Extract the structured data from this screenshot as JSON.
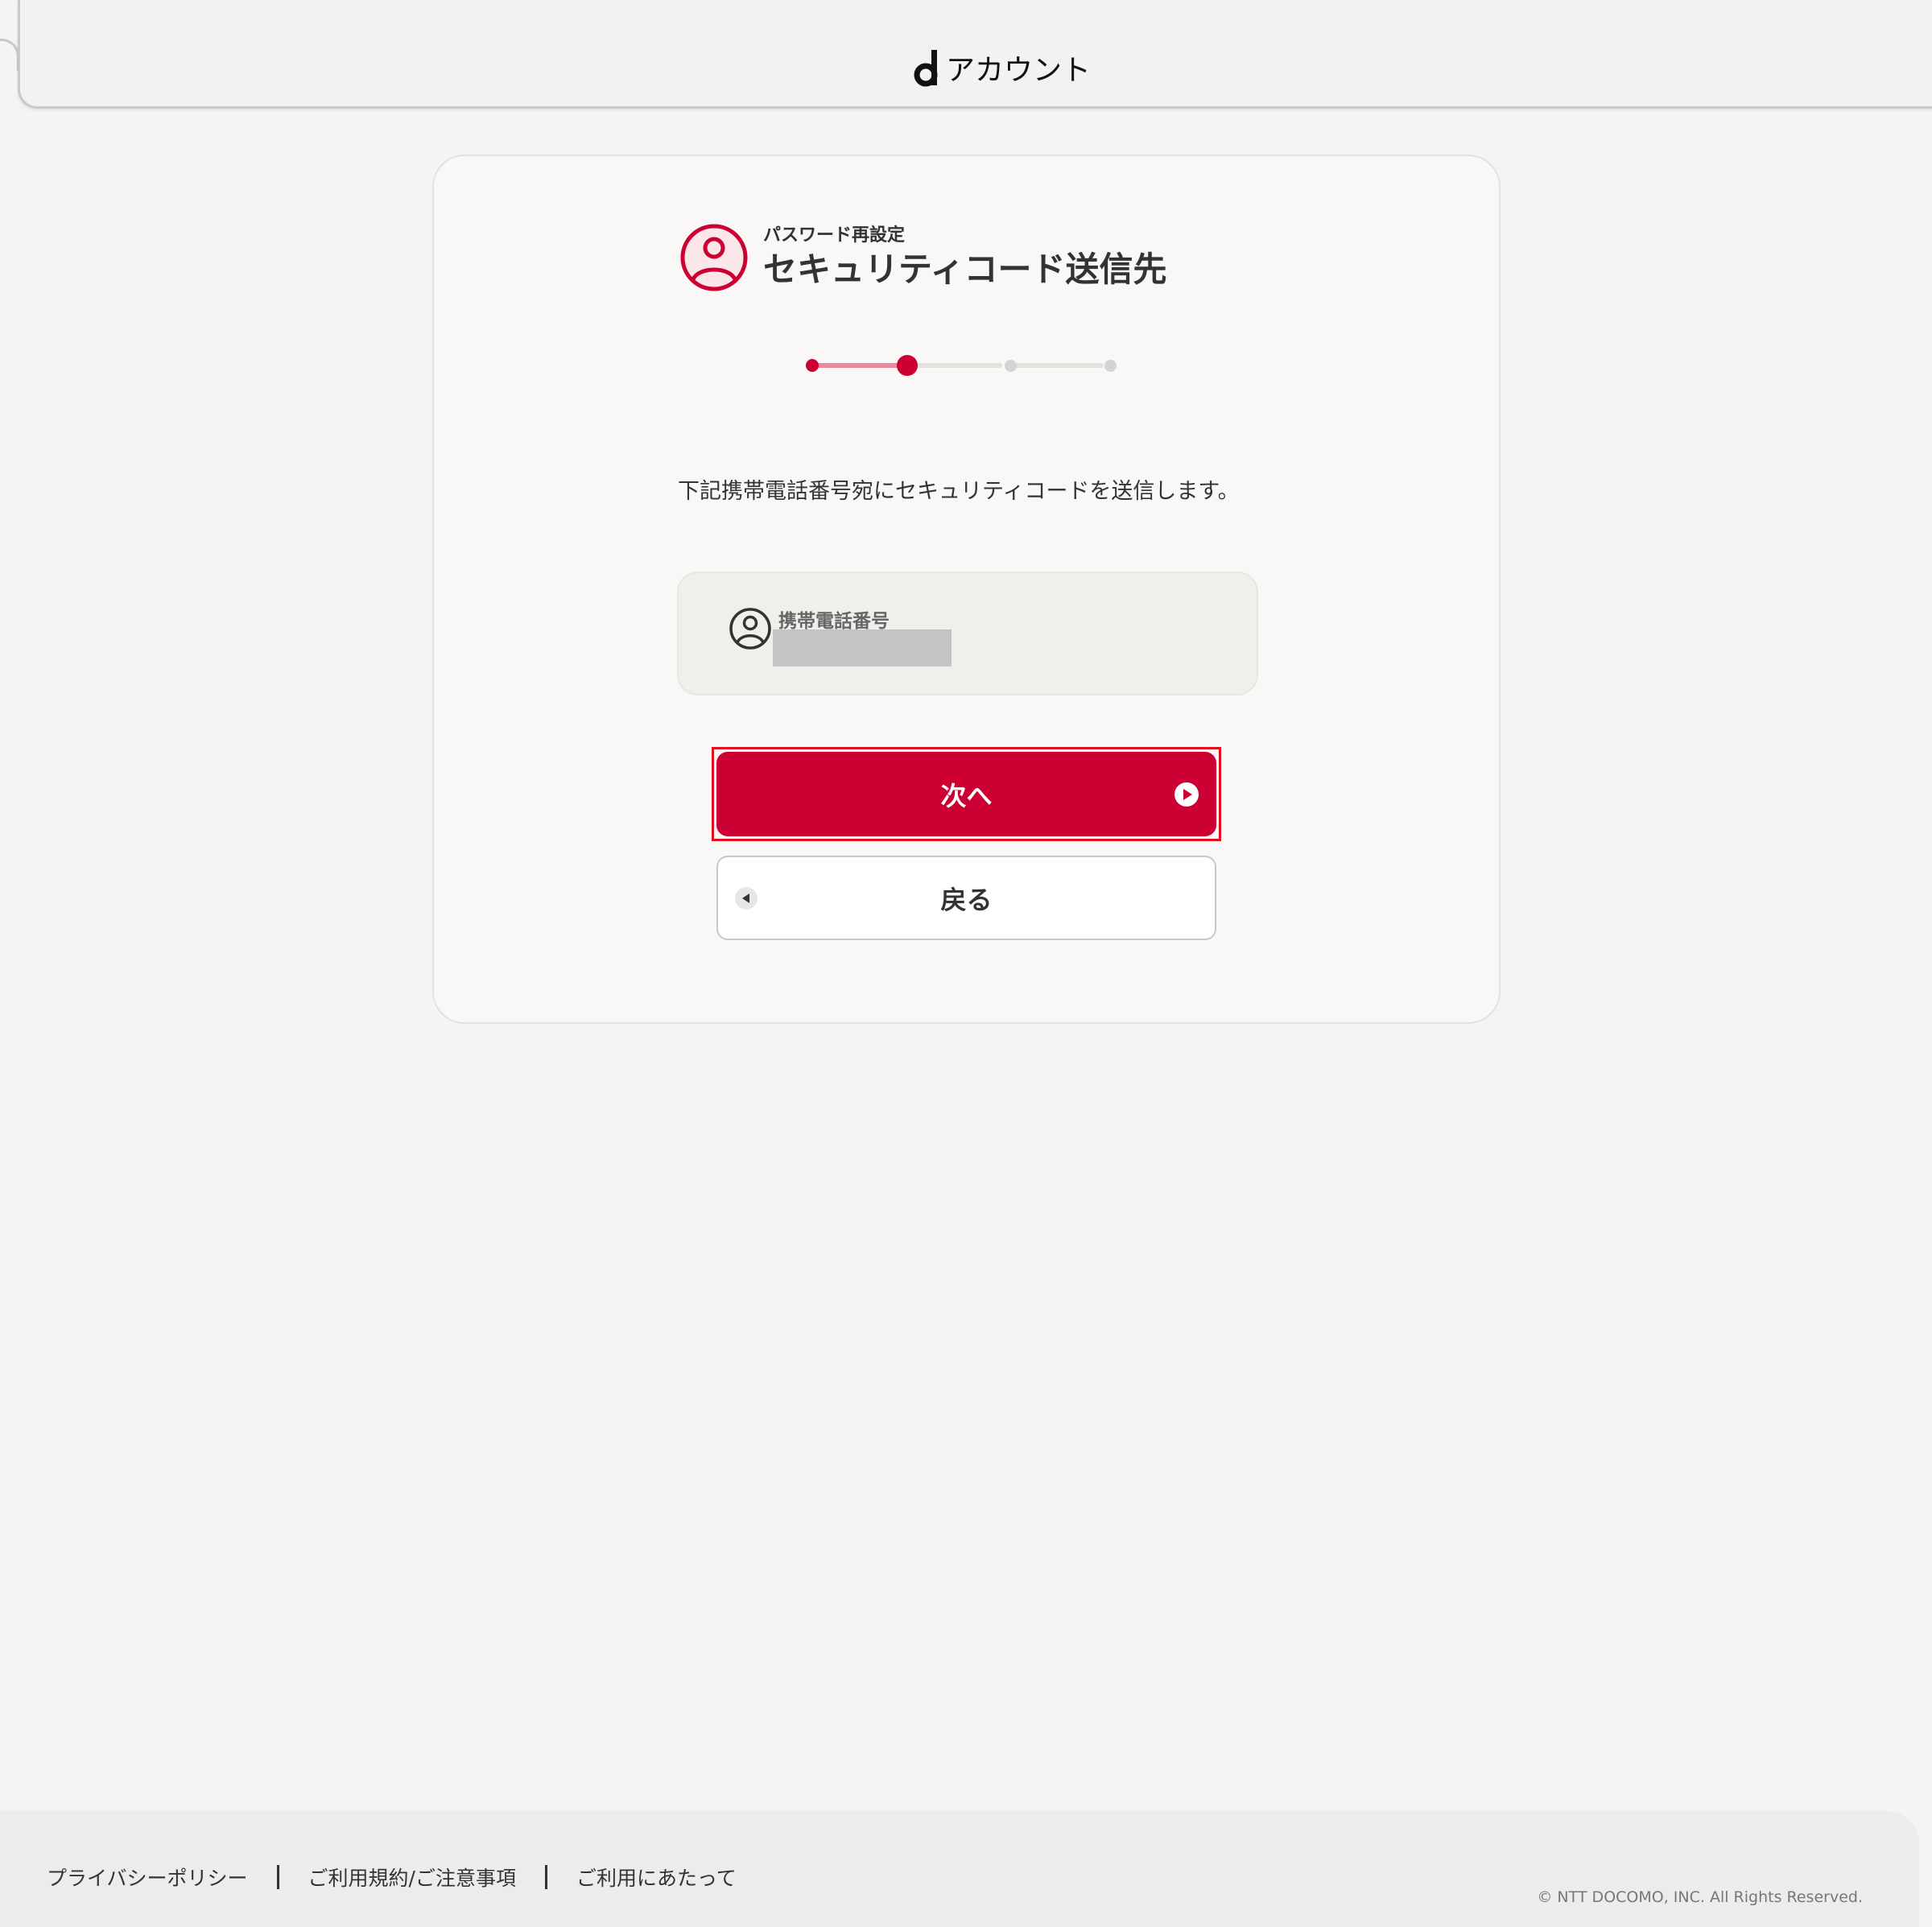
{
  "header": {
    "logo_text": "アカウント",
    "logo_icon": "d-logo-icon"
  },
  "card": {
    "subtitle": "パスワード再設定",
    "title": "セキュリティコード送信先",
    "title_icon": "user-circle-icon",
    "stepper": {
      "total_steps": 4,
      "current_step": 2
    },
    "description": "下記携帯電話番号宛にセキュリティコードを送信します。",
    "phone": {
      "label": "携帯電話番号",
      "value": "",
      "icon": "user-circle-icon"
    },
    "next_button": {
      "label": "次へ",
      "icon": "play-circle-icon"
    },
    "back_button": {
      "label": "戻る",
      "icon": "back-arrow-icon"
    }
  },
  "footer": {
    "links": [
      "プライバシーポリシー",
      "ご利用規約/ご注意事項",
      "ご利用にあたって"
    ],
    "copyright": "© NTT DOCOMO, INC. All Rights Reserved."
  },
  "colors": {
    "accent": "#cc0033",
    "accent_light": "#e8899e",
    "inactive": "#d9d9d9",
    "background": "#f5f4f2"
  }
}
